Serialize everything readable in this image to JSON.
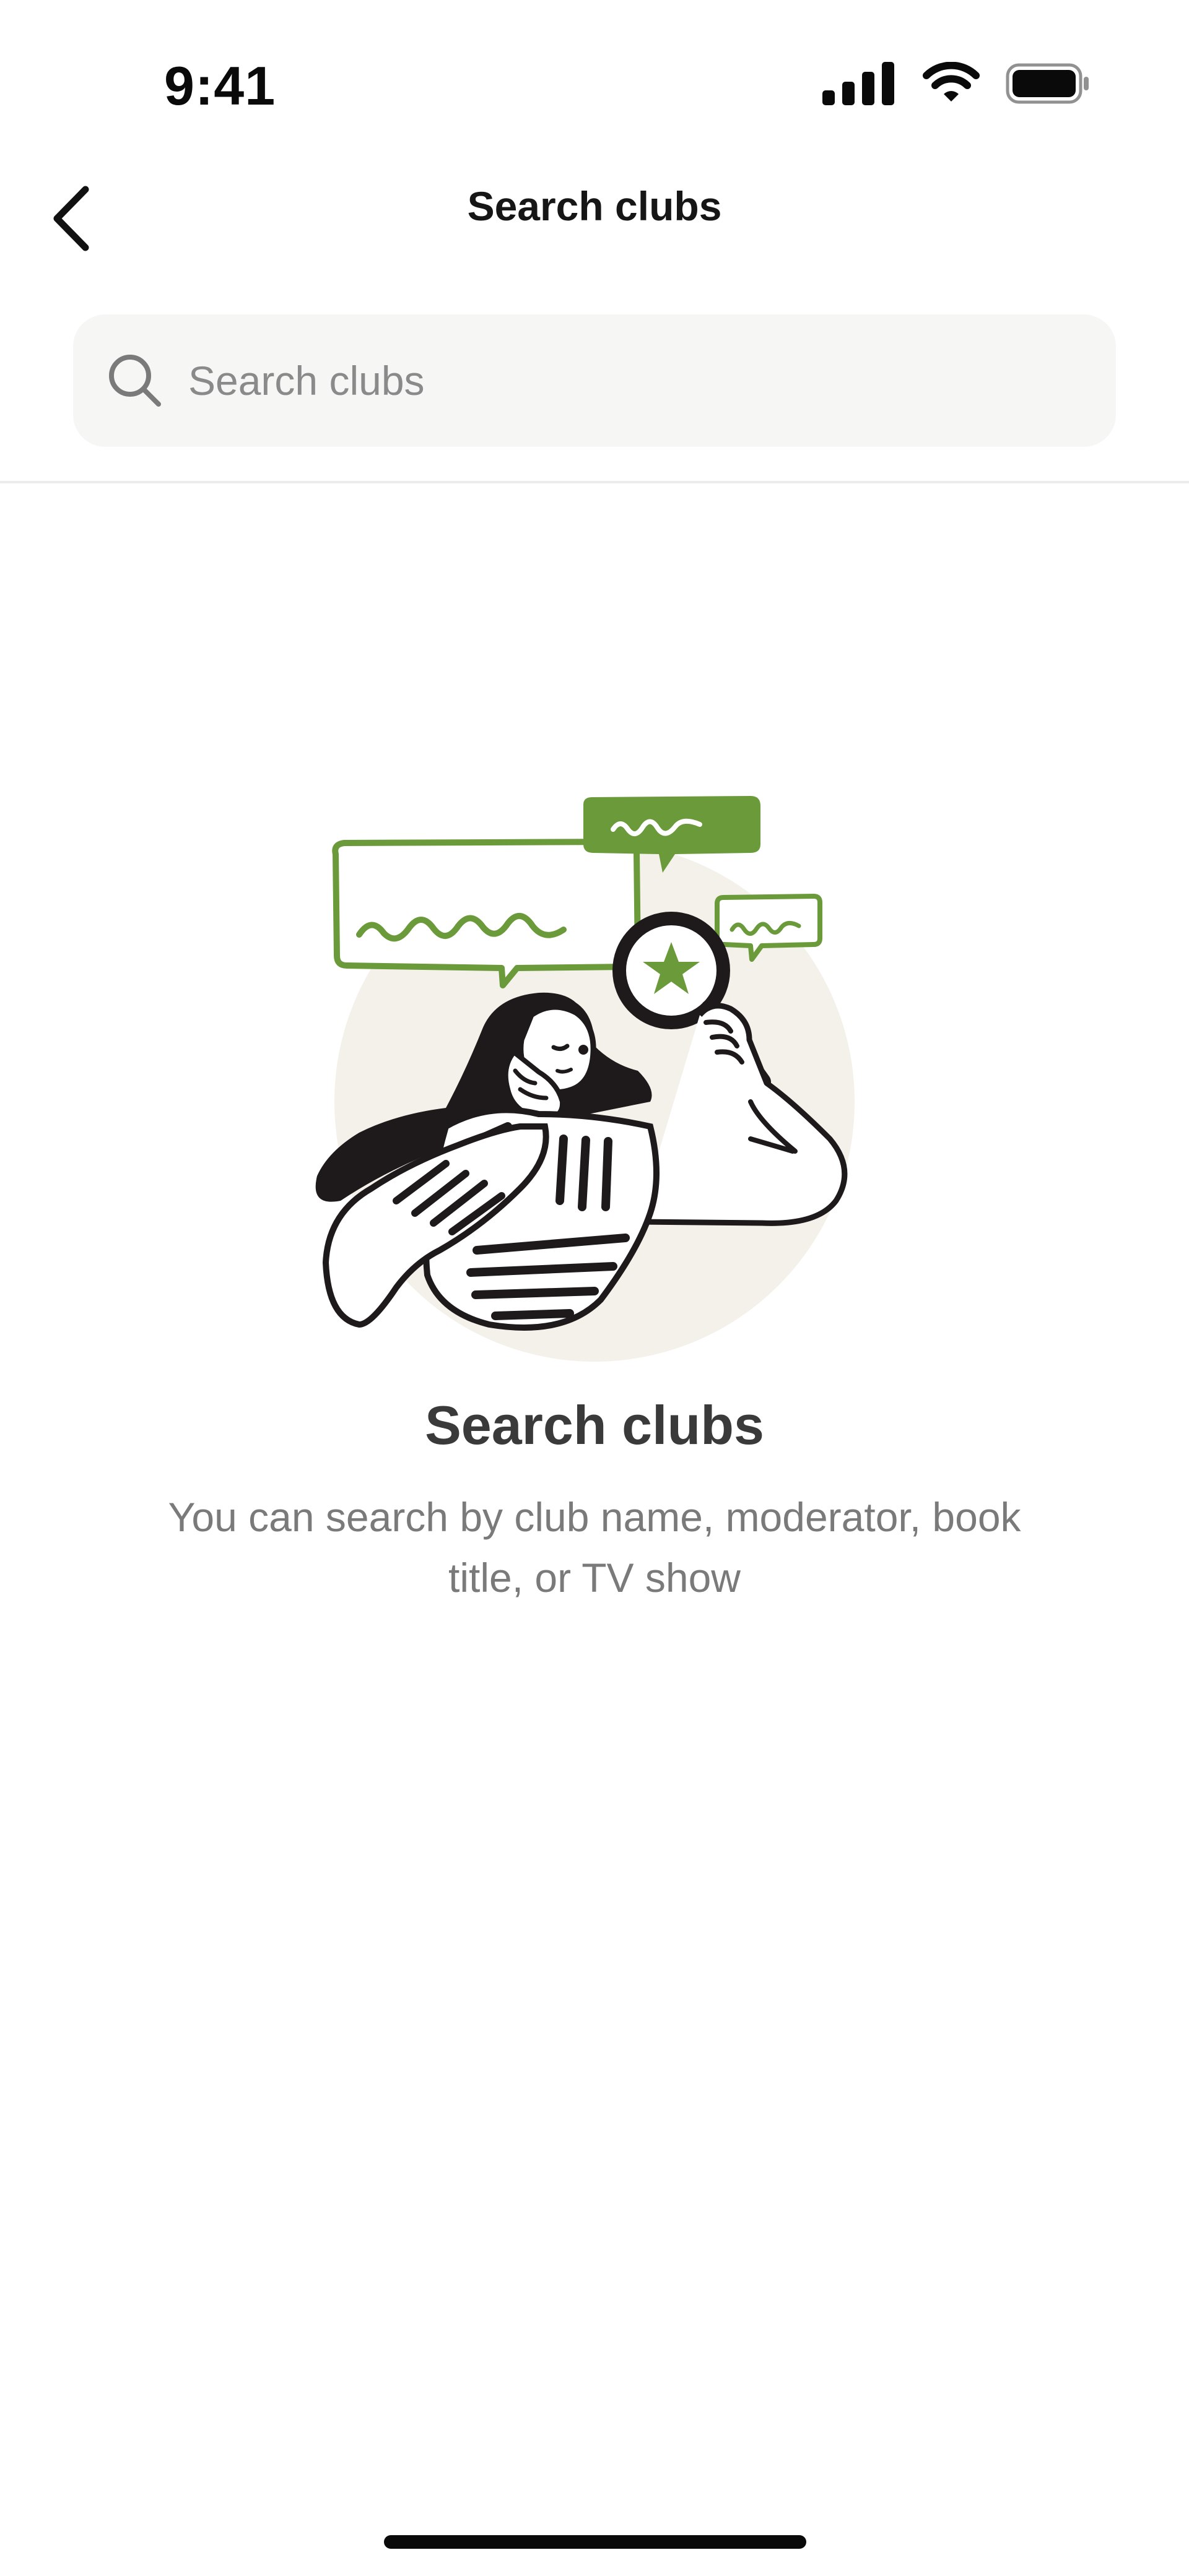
{
  "status_bar": {
    "time": "9:41",
    "icons": [
      "cellular-signal-icon",
      "wifi-icon",
      "battery-icon"
    ]
  },
  "nav": {
    "title": "Search clubs",
    "back_icon": "chevron-left-icon"
  },
  "search": {
    "placeholder": "Search clubs",
    "value": "",
    "icon": "search-icon"
  },
  "empty_state": {
    "illustration": "woman-with-magnifying-glass-illustration",
    "title": "Search clubs",
    "description": "You can search by club name, moderator, book title, or TV show"
  },
  "colors": {
    "accent_green": "#6a9a3a",
    "background": "#ffffff",
    "search_bg": "#f6f6f5",
    "circle_bg": "#f4f1ea"
  }
}
